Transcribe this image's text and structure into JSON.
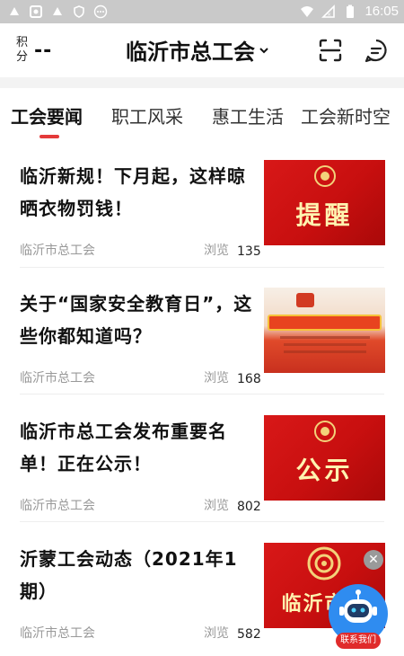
{
  "status_bar": {
    "time": "16:05"
  },
  "header": {
    "score_label": "积分",
    "score_value": "--",
    "city": "临沂市总工会"
  },
  "tabs": [
    {
      "label": "工会要闻"
    },
    {
      "label": "职工风采"
    },
    {
      "label": "惠工生活"
    },
    {
      "label": "工会新时空"
    }
  ],
  "articles": [
    {
      "title": "临沂新规！下月起，这样晾晒衣物罚钱！",
      "source": "临沂市总工会",
      "views_label": "浏览",
      "views": "135",
      "thumb_text": "提醒"
    },
    {
      "title": "关于“国家安全教育日”，这些你都知道吗？",
      "source": "临沂市总工会",
      "views_label": "浏览",
      "views": "168",
      "thumb_text": ""
    },
    {
      "title": "临沂市总工会发布重要名单！正在公示！",
      "source": "临沂市总工会",
      "views_label": "浏览",
      "views": "802",
      "thumb_text": "公示"
    },
    {
      "title": "沂蒙工会动态（2021年1期）",
      "source": "临沂市总工会",
      "views_label": "浏览",
      "views": "582",
      "thumb_text": "临沂市总"
    }
  ],
  "floating": {
    "contact_label": "联系我们"
  },
  "colors": {
    "accent": "#e43a3a",
    "thumb_red": "#d81818",
    "fab_blue": "#2f8cf0"
  }
}
